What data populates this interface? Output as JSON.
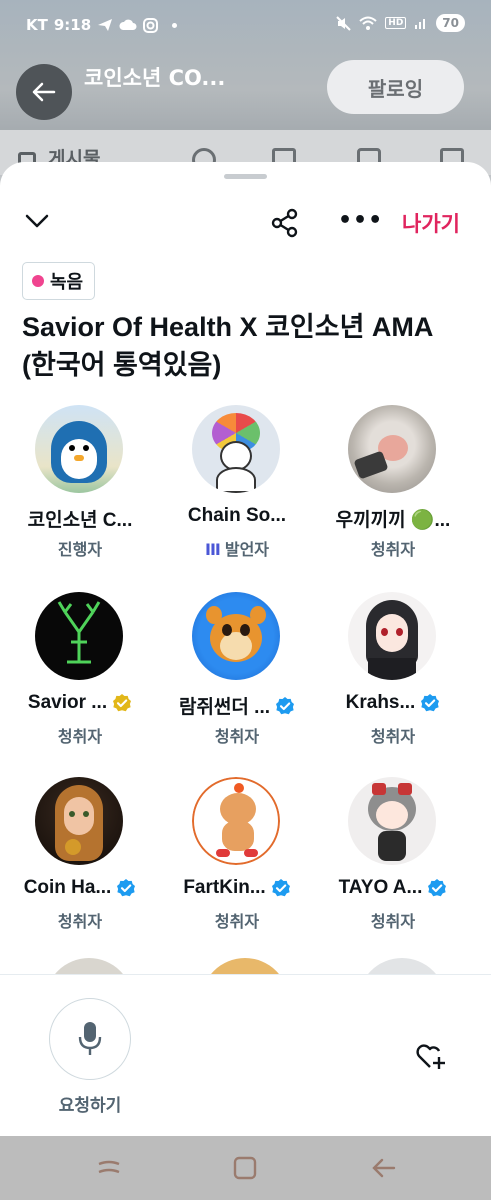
{
  "status_bar": {
    "carrier": "KT",
    "time": "9:18",
    "battery": "70"
  },
  "profile_header": {
    "title": "코인소년 CO...",
    "follow_label": "팔로잉"
  },
  "behind_tabs": {
    "first_label": "게시물"
  },
  "space": {
    "leave_label": "나가기",
    "badge_label": "녹음",
    "title": "Savior Of Health X 코인소년 AMA (한국어 통역있음)",
    "accent_color": "#e0245e",
    "verified_color": "#1d9bf0",
    "gold_color": "#e2b719"
  },
  "participants": [
    {
      "name": "코인소년 C...",
      "role": "진행자",
      "verified": "none",
      "avatar_icon": "penguin-avatar-icon"
    },
    {
      "name": "Chain So...",
      "role": "발언자",
      "verified": "none",
      "avatar_icon": "snowman-avatar-icon"
    },
    {
      "name": "우끼끼끼 🟢...",
      "role": "청취자",
      "verified": "none",
      "avatar_icon": "monkey-avatar-icon"
    },
    {
      "name": "Savior ...",
      "role": "청취자",
      "verified": "gold",
      "avatar_icon": "deer-avatar-icon"
    },
    {
      "name": "람쥐썬더 ...",
      "role": "청취자",
      "verified": "blue",
      "avatar_icon": "squirrel-avatar-icon"
    },
    {
      "name": "Krahs...",
      "role": "청취자",
      "verified": "blue",
      "avatar_icon": "anime-girl-avatar-icon"
    },
    {
      "name": "Coin Ha...",
      "role": "청취자",
      "verified": "blue",
      "avatar_icon": "girl-portrait-avatar-icon"
    },
    {
      "name": "FartKin...",
      "role": "청취자",
      "verified": "blue",
      "avatar_icon": "bear-avatar-icon"
    },
    {
      "name": "TAYO A...",
      "role": "청취자",
      "verified": "blue",
      "avatar_icon": "chibi-avatar-icon"
    }
  ],
  "footer": {
    "request_label": "요청하기"
  }
}
